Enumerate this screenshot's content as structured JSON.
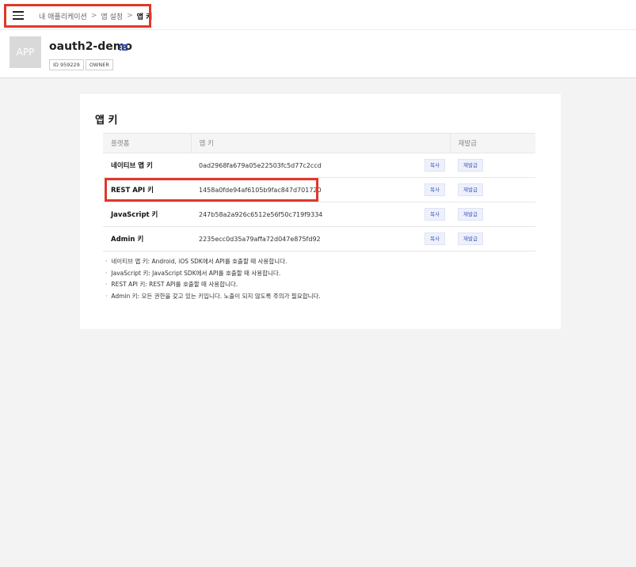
{
  "breadcrumb": {
    "items": [
      "내 애플리케이션",
      "앱 설정",
      "앱 키"
    ],
    "separator": ">"
  },
  "app": {
    "thumb_label": "APP",
    "name": "oauth2-demo",
    "tags": [
      "ID 959229",
      "OWNER"
    ]
  },
  "card": {
    "title": "앱 키",
    "columns": [
      "플랫폼",
      "앱 키",
      "재발급"
    ],
    "rows": [
      {
        "platform": "네이티브 앱 키",
        "key": "0ad2968fa679a05e22503fc5d77c2ccd",
        "copy": "복사",
        "reissue": "재발급"
      },
      {
        "platform": "REST API 키",
        "key": "1458a0fde94af6105b9fac847d701720",
        "copy": "복사",
        "reissue": "재발급"
      },
      {
        "platform": "JavaScript 키",
        "key": "247b58a2a926c6512e56f50c719f9334",
        "copy": "복사",
        "reissue": "재발급"
      },
      {
        "platform": "Admin 키",
        "key": "2235ecc0d35a79affa72d047e875fd92",
        "copy": "복사",
        "reissue": "재발급"
      }
    ],
    "notes": [
      "네이티브 앱 키: Android, iOS SDK에서 API를 호출할 때 사용합니다.",
      "JavaScript 키: JavaScript SDK에서 API를 호출할 때 사용합니다.",
      "REST API 키: REST API를 호출할 때 사용합니다.",
      "Admin 키: 모든 권한을 갖고 있는 키입니다. 노출이 되지 않도록 주의가 필요합니다."
    ]
  },
  "colors": {
    "highlight": "#e0382b",
    "accent": "#3a56c5"
  },
  "icons": [
    "hamburger-menu-icon",
    "list-icon"
  ]
}
